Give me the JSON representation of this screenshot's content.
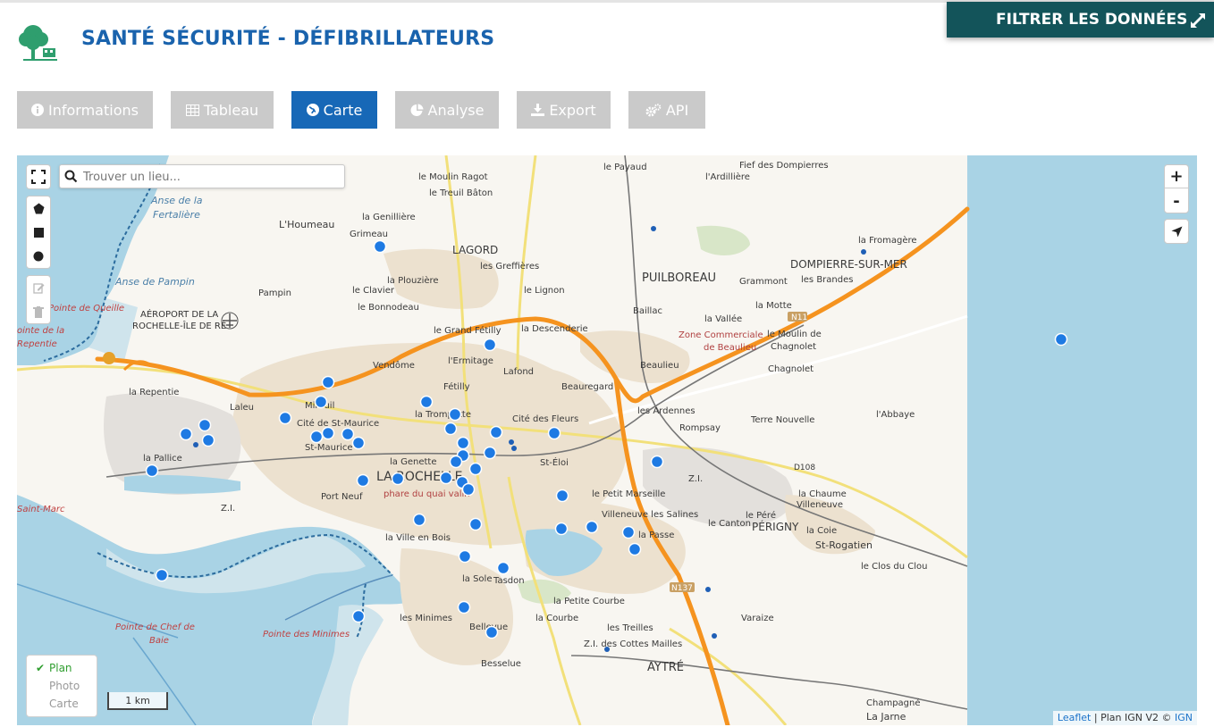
{
  "header": {
    "title": "SANTÉ SÉCURITÉ - DÉFIBRILLATEURS",
    "filter_button": "FILTRER LES DONNÉES"
  },
  "tabs": [
    {
      "label": "Informations",
      "icon": "info-circle-icon",
      "active": false
    },
    {
      "label": "Tableau",
      "icon": "table-icon",
      "active": false
    },
    {
      "label": "Carte",
      "icon": "globe-icon",
      "active": true
    },
    {
      "label": "Analyse",
      "icon": "pie-chart-icon",
      "active": false
    },
    {
      "label": "Export",
      "icon": "download-icon",
      "active": false
    },
    {
      "label": "API",
      "icon": "cogs-icon",
      "active": false
    }
  ],
  "colors": {
    "title": "#1a63ad",
    "active_tab": "#1768b7",
    "inactive_tab": "#cacaca",
    "filter_button": "#13545a",
    "marker": "#1e7ae3",
    "water": "#a8d4e6",
    "motorway": "#f5931f"
  },
  "map": {
    "search_placeholder": "Trouver un lieu...",
    "zoom_in": "+",
    "zoom_out": "-",
    "layers": [
      {
        "label": "Plan",
        "selected": true,
        "check": "✔"
      },
      {
        "label": "Photo",
        "selected": false
      },
      {
        "label": "Carte",
        "selected": false
      }
    ],
    "scale": "1 km",
    "attribution": {
      "leaflet": "Leaflet",
      "sep": " | ",
      "plan": "Plan IGN V2 © ",
      "ign": "IGN"
    },
    "place_labels": [
      {
        "text": "le Payaud",
        "size": 10
      },
      {
        "text": "Fief des Dompierres",
        "size": 10
      },
      {
        "text": "le Moulin Ragot",
        "size": 10
      },
      {
        "text": "l'Ardillière",
        "size": 10
      },
      {
        "text": "le Treuil Bâton",
        "size": 10
      },
      {
        "text": "Anse de la",
        "size": 11,
        "color": "#4a7fa8",
        "italic": true
      },
      {
        "text": "Fertalière",
        "size": 11,
        "color": "#4a7fa8",
        "italic": true
      },
      {
        "text": "la Genillière",
        "size": 10
      },
      {
        "text": "L'Houmeau",
        "size": 11
      },
      {
        "text": "Grimeau",
        "size": 10
      },
      {
        "text": "LAGORD",
        "size": 12
      },
      {
        "text": "la Fromagère",
        "size": 10
      },
      {
        "text": "les Greffières",
        "size": 10
      },
      {
        "text": "PUILBOREAU",
        "size": 13
      },
      {
        "text": "DOMPIERRE-SUR-MER",
        "size": 12
      },
      {
        "text": "Anse de Pampin",
        "size": 11,
        "color": "#4a7fa8",
        "italic": true
      },
      {
        "text": "Pampin",
        "size": 10
      },
      {
        "text": "la Plouzière",
        "size": 10
      },
      {
        "text": "Grammont",
        "size": 10
      },
      {
        "text": "les Brandes",
        "size": 10
      },
      {
        "text": "le Clavier",
        "size": 10
      },
      {
        "text": "le Lignon",
        "size": 10
      },
      {
        "text": "Pointe de Queille",
        "size": 10,
        "color": "#c04040",
        "italic": true
      },
      {
        "text": "le Bonnodeau",
        "size": 10
      },
      {
        "text": "Baillac",
        "size": 10
      },
      {
        "text": "la Motte",
        "size": 10
      },
      {
        "text": "AÉROPORT DE LA",
        "size": 10,
        "color": "#333"
      },
      {
        "text": "ROCHELLE-ÎLE DE RÉ",
        "size": 10,
        "color": "#333"
      },
      {
        "text": "la Vallée",
        "size": 10
      },
      {
        "text": "N11",
        "size": 9,
        "color": "#fff"
      },
      {
        "text": "la Descenderie",
        "size": 10
      },
      {
        "text": "le Grand Fétilly",
        "size": 10
      },
      {
        "text": "Zone Commerciale",
        "size": 10,
        "color": "#b04040"
      },
      {
        "text": "de Beaulieu",
        "size": 10,
        "color": "#b04040"
      },
      {
        "text": "le Moulin de",
        "size": 10
      },
      {
        "text": "Chagnolet",
        "size": 10
      },
      {
        "text": "ointe de la",
        "size": 10,
        "color": "#c04040",
        "italic": true
      },
      {
        "text": "Repentie",
        "size": 10,
        "color": "#c04040",
        "italic": true
      },
      {
        "text": "Vendôme",
        "size": 10
      },
      {
        "text": "l'Ermitage",
        "size": 10
      },
      {
        "text": "Lafond",
        "size": 10
      },
      {
        "text": "Beaulieu",
        "size": 10
      },
      {
        "text": "Chagnolet",
        "size": 10
      },
      {
        "text": "la Repentie",
        "size": 10
      },
      {
        "text": "Fétilly",
        "size": 10
      },
      {
        "text": "Beauregard",
        "size": 10
      },
      {
        "text": "Mireuil",
        "size": 10
      },
      {
        "text": "Laleu",
        "size": 10
      },
      {
        "text": "la Trompette",
        "size": 10
      },
      {
        "text": "les Ardennes",
        "size": 10
      },
      {
        "text": "Terre Nouvelle",
        "size": 10
      },
      {
        "text": "l'Abbaye",
        "size": 10
      },
      {
        "text": "Cité de St-Maurice",
        "size": 10
      },
      {
        "text": "Cité des Fleurs",
        "size": 10
      },
      {
        "text": "Rompsay",
        "size": 10
      },
      {
        "text": "St-Maurice",
        "size": 10
      },
      {
        "text": "la Pallice",
        "size": 10
      },
      {
        "text": "la Genette",
        "size": 10
      },
      {
        "text": "St-Éloi",
        "size": 10
      },
      {
        "text": "D108",
        "size": 9
      },
      {
        "text": "LA ROCHELLE",
        "size": 14
      },
      {
        "text": "Z.I.",
        "size": 10
      },
      {
        "text": "phare du quai valin",
        "size": 10,
        "color": "#b04040"
      },
      {
        "text": "Port Neuf",
        "size": 10
      },
      {
        "text": "le Petit Marseille",
        "size": 10
      },
      {
        "text": "la Chaume",
        "size": 10
      },
      {
        "text": "Villeneuve",
        "size": 10
      },
      {
        "text": "Saint-Marc",
        "size": 10,
        "color": "#c04040",
        "italic": true
      },
      {
        "text": "Z.I.",
        "size": 10
      },
      {
        "text": "Villeneuve les Salines",
        "size": 10
      },
      {
        "text": "le Péré",
        "size": 10
      },
      {
        "text": "le Canton",
        "size": 10
      },
      {
        "text": "PÉRIGNY",
        "size": 12
      },
      {
        "text": "la Ville en Bois",
        "size": 10
      },
      {
        "text": "la Passe",
        "size": 10
      },
      {
        "text": "la Coie",
        "size": 10
      },
      {
        "text": "St-Rogatien",
        "size": 11
      },
      {
        "text": "le Clos du Clou",
        "size": 10
      },
      {
        "text": "la Sole",
        "size": 10
      },
      {
        "text": "Tasdon",
        "size": 10
      },
      {
        "text": "N137",
        "size": 9,
        "color": "#fff"
      },
      {
        "text": "la Petite Courbe",
        "size": 10
      },
      {
        "text": "les Minimes",
        "size": 10
      },
      {
        "text": "la Courbe",
        "size": 10
      },
      {
        "text": "Varaize",
        "size": 10
      },
      {
        "text": "Pointe de Chef de",
        "size": 10,
        "color": "#c04040",
        "italic": true
      },
      {
        "text": "Baie",
        "size": 10,
        "color": "#c04040",
        "italic": true
      },
      {
        "text": "Bellevue",
        "size": 10
      },
      {
        "text": "les Treilles",
        "size": 10
      },
      {
        "text": "Pointe des Minimes",
        "size": 10,
        "color": "#c04040",
        "italic": true
      },
      {
        "text": "Z.I. des Cottes Mailles",
        "size": 10
      },
      {
        "text": "Besselue",
        "size": 10
      },
      {
        "text": "AYTRÉ",
        "size": 13
      },
      {
        "text": "Champagné",
        "size": 10
      },
      {
        "text": "La Jarne",
        "size": 11
      }
    ]
  }
}
